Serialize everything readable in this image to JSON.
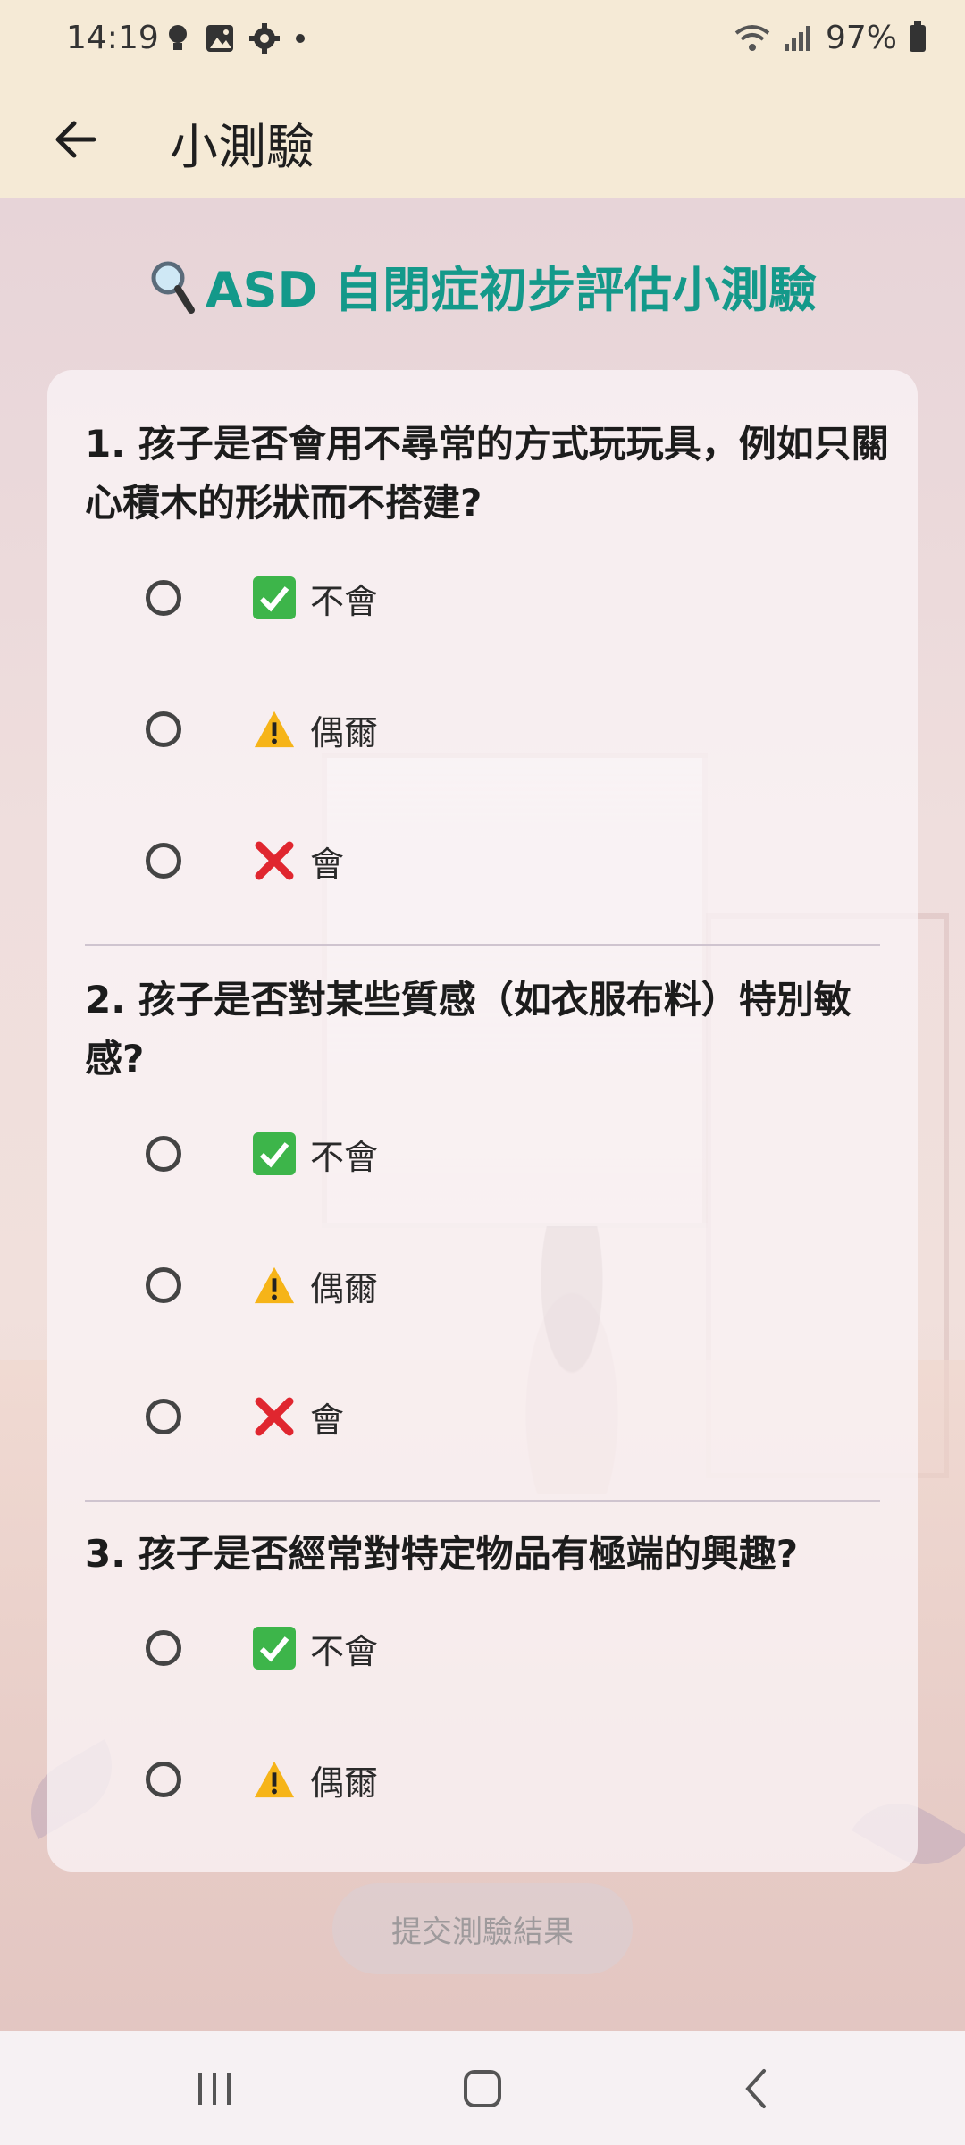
{
  "status_bar": {
    "time": "14:19",
    "battery": "97%"
  },
  "app_bar": {
    "title": "小測驗"
  },
  "quiz": {
    "title": "ASD 自閉症初步評估小測驗",
    "questions": [
      {
        "text": "1. 孩子是否會用不尋常的方式玩玩具，例如只關心積木的形狀而不搭建?",
        "options": [
          "不會",
          "偶爾",
          "會"
        ]
      },
      {
        "text": "2. 孩子是否對某些質感（如衣服布料）特別敏感?",
        "options": [
          "不會",
          "偶爾",
          "會"
        ]
      },
      {
        "text": "3. 孩子是否經常對特定物品有極端的興趣?",
        "options": [
          "不會",
          "偶爾"
        ]
      }
    ],
    "submit_label": "提交測驗結果"
  },
  "icons": {
    "title_icon": "magnifier-icon",
    "option_icons": [
      "check-mark-icon",
      "warning-icon",
      "cross-mark-icon"
    ]
  },
  "colors": {
    "accent": "#14998a",
    "app_bar_bg": "#f5ead6"
  }
}
